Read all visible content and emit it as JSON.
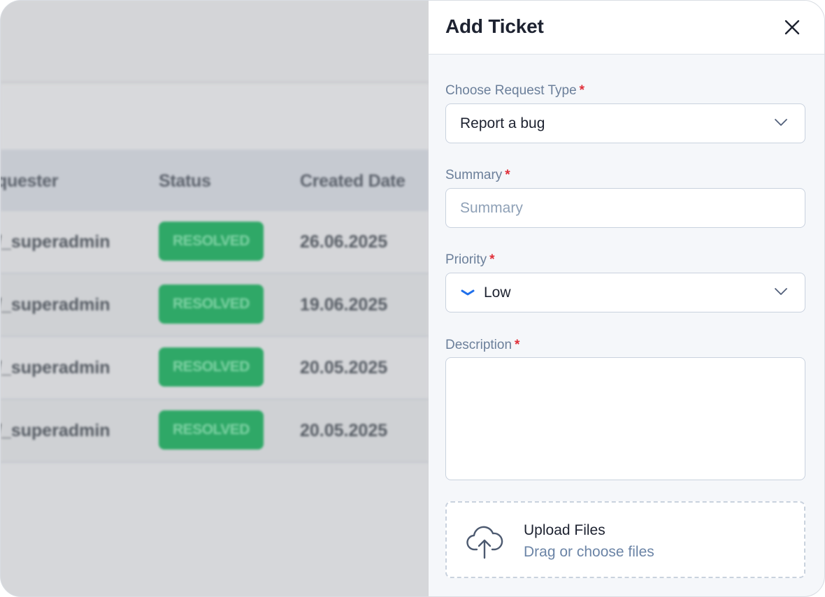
{
  "background": {
    "table": {
      "columns": [
        "quester",
        "Status",
        "Created Date"
      ],
      "rows": [
        {
          "requester": "/_superadmin",
          "status": "RESOLVED",
          "created": "26.06.2025"
        },
        {
          "requester": "/_superadmin",
          "status": "RESOLVED",
          "created": "19.06.2025"
        },
        {
          "requester": "/_superadmin",
          "status": "RESOLVED",
          "created": "20.05.2025"
        },
        {
          "requester": "/_superadmin",
          "status": "RESOLVED",
          "created": "20.05.2025"
        }
      ]
    }
  },
  "drawer": {
    "title": "Add Ticket",
    "close_icon": "close-icon",
    "request_type": {
      "label": "Choose Request Type",
      "required": "*",
      "value": "Report a bug"
    },
    "summary": {
      "label": "Summary",
      "required": "*",
      "placeholder": "Summary",
      "value": ""
    },
    "priority": {
      "label": "Priority",
      "required": "*",
      "value": "Low",
      "icon": "chevron-down-priority-icon",
      "icon_color": "#1f6feb"
    },
    "description": {
      "label": "Description",
      "required": "*",
      "value": ""
    },
    "upload": {
      "title": "Upload Files",
      "subtitle": "Drag or choose files",
      "icon": "cloud-upload-icon"
    }
  },
  "colors": {
    "required_star": "#e0303a",
    "label": "#6b7f9a",
    "status_badge": "#2fa867",
    "link_text": "#6b84a6"
  }
}
